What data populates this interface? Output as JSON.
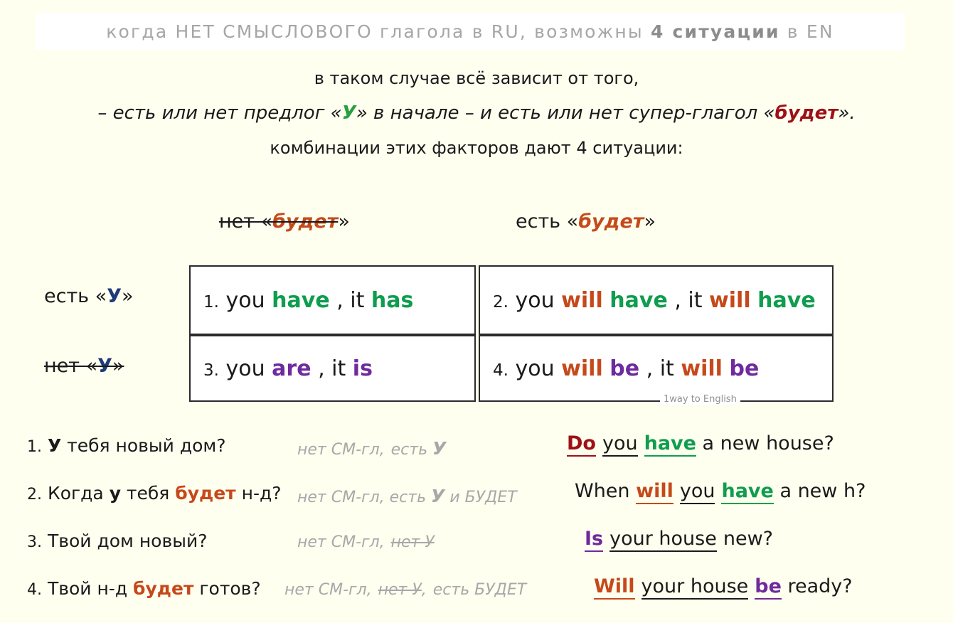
{
  "header": {
    "text_before": "когда НЕТ СМЫСЛОВОГО глагола в RU, возможны ",
    "highlight": "4 ситуации",
    "text_after": " в EN"
  },
  "intro": {
    "line1": "в таком случае всё зависит от того,",
    "line2_part1": "– есть или нет предлог «",
    "line2_u": "У",
    "line2_part2": "» в начале – и есть или нет супер-глагол «",
    "line2_budet": "будет",
    "line2_part3": "».",
    "line3": "комбинации этих факторов дают 4 ситуации:"
  },
  "matrix": {
    "col_headers": [
      {
        "prefix": "нет «",
        "word": "будет",
        "suffix": "»",
        "struck": true
      },
      {
        "prefix": "есть «",
        "word": "будет",
        "suffix": "»",
        "struck": false
      }
    ],
    "row_headers": [
      {
        "prefix": "есть «",
        "word": "У",
        "suffix": "»",
        "struck": false
      },
      {
        "prefix": "нет «",
        "word": "У",
        "suffix": "»",
        "struck": true
      }
    ],
    "cells": [
      {
        "num": "1.",
        "p1": " you ",
        "w1": "have",
        "p2": " , it ",
        "w2": "has",
        "w1_color": "green",
        "w2_color": "green",
        "aux": "",
        "aux2": ""
      },
      {
        "num": "2.",
        "p1": " you ",
        "w1": "will",
        "p2": " , it ",
        "w2": "will",
        "w1_color": "orange",
        "w2_color": "orange",
        "aux": "have",
        "aux2": "have"
      },
      {
        "num": "3.",
        "p1": " you ",
        "w1": "are",
        "p2": " , it ",
        "w2": "is",
        "w1_color": "purple",
        "w2_color": "purple",
        "aux": "",
        "aux2": ""
      },
      {
        "num": "4.",
        "p1": " you ",
        "w1": "will",
        "p2": " , it ",
        "w2": "will",
        "w1_color": "orange",
        "w2_color": "orange",
        "aux": "be",
        "aux2": "be"
      }
    ],
    "watermark": "1way to English"
  },
  "examples": [
    {
      "num": "1.",
      "ru_bold": "У",
      "ru_rest": " тебя новый дом?",
      "note_1": "нет СМ-гл,",
      "note_2": "есть",
      "note_3": "У",
      "en": "Do you have a new house?",
      "en_words": {
        "w1": "Do",
        "w2": "you",
        "w3": "have",
        "tail": "a new house?"
      }
    },
    {
      "num": "2.",
      "ru_pre": "Когда ",
      "ru_bold": "у",
      "ru_mid": " тебя ",
      "ru_budet": "будет",
      "ru_rest": " н-д?",
      "note_1": "нет СМ-гл,",
      "note_2": "есть",
      "note_3": "У",
      "note_4": "и БУДЕТ",
      "en_words": {
        "lead": "When",
        "w1": "will",
        "w2": "you",
        "w3": "have",
        "tail": "a new h?"
      }
    },
    {
      "num": "3.",
      "ru_rest": "Твой дом новый?",
      "note_1": "нет СМ-гл,",
      "note_struck": "нет У",
      "en_words": {
        "w1": "Is",
        "w2": "your house",
        "tail": "new?"
      }
    },
    {
      "num": "4.",
      "ru_pre": "Твой н-д ",
      "ru_budet": "будет",
      "ru_rest": " готов?",
      "note_1": "нет СМ-гл,",
      "note_struck": "нет У",
      "note_comma": ",",
      "note_2": "есть БУДЕТ",
      "en_words": {
        "w1": "Will",
        "w2": "your house",
        "w3": "be",
        "tail": "ready?"
      }
    }
  ],
  "colors": {
    "background": "#fffff0",
    "header_gray": "#a6a6a6",
    "green": "#0f9d4e",
    "orange": "#c5491a",
    "purple": "#6e2a9e",
    "dark_red": "#9e1016",
    "navy": "#1f3a78",
    "note_gray": "#a8a8a8"
  }
}
